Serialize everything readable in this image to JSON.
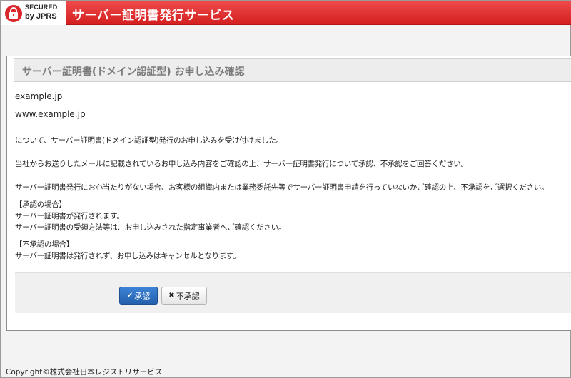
{
  "header": {
    "logo_line1": "SECURED",
    "logo_line2": "by JPRS",
    "title": "サーバー証明書発行サービス",
    "color": "#e03232"
  },
  "panel": {
    "title": "サーバー証明書(ドメイン認証型) お申し込み確認",
    "domains": [
      "example.jp",
      "www.example.jp"
    ],
    "paragraphs": [
      "について、サーバー証明書(ドメイン認証型)発行のお申し込みを受け付けました。",
      "当社からお送りしたメールに記載されているお申し込み内容をご確認の上、サーバー証明書発行について承認、不承認をご回答ください。",
      "サーバー証明書発行にお心当たりがない場合、お客様の組織内または業務委託先等でサーバー証明書申請を行っていないかご確認の上、不承認をご選択ください。"
    ],
    "approve_section": {
      "heading": "【承認の場合】",
      "lines": [
        "サーバー証明書が発行されます。",
        "サーバー証明書の受領方法等は、お申し込みされた指定事業者へご確認ください。"
      ]
    },
    "reject_section": {
      "heading": "【不承認の場合】",
      "lines": [
        "サーバー証明書は発行されず、お申し込みはキャンセルとなります。"
      ]
    }
  },
  "actions": {
    "approve_label": "承認",
    "approve_icon": "check-icon",
    "reject_label": "不承認",
    "reject_icon": "x-icon"
  },
  "footer": {
    "copyright": "Copyright©株式会社日本レジストリサービス"
  }
}
